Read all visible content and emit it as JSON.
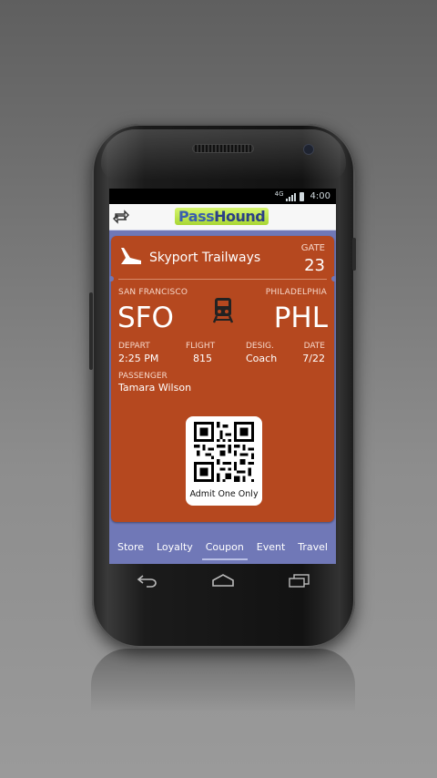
{
  "status_bar": {
    "network": "4G",
    "time": "4:00"
  },
  "app": {
    "logo_part1": "Pass",
    "logo_part2": "Hound"
  },
  "pass": {
    "airline": "Skyport Trailways",
    "gate_label": "GATE",
    "gate": "23",
    "origin_city": "SAN FRANCISCO",
    "origin_code": "SFO",
    "destination_city": "PHILADELPHIA",
    "destination_code": "PHL",
    "depart_label": "DEPART",
    "depart": "2:25 PM",
    "flight_label": "FLIGHT",
    "flight": "815",
    "desig_label": "DESIG.",
    "desig": "Coach",
    "date_label": "DATE",
    "date": "7/22",
    "passenger_label": "PASSENGER",
    "passenger": "Tamara Wilson",
    "qr_caption": "Admit One Only"
  },
  "tabs": [
    {
      "label": "Store"
    },
    {
      "label": "Loyalty"
    },
    {
      "label": "Coupon"
    },
    {
      "label": "Event"
    },
    {
      "label": "Travel"
    }
  ],
  "active_tab": "Coupon",
  "colors": {
    "pass_background": "#b5481f",
    "tab_bar": "#7078b7",
    "logo_green": "#a9d734",
    "logo_blue": "#3b5fae"
  },
  "icons": [
    "sync-icon",
    "plane-icon",
    "train-icon",
    "qr-code",
    "back-icon",
    "home-icon",
    "recent-apps-icon"
  ]
}
